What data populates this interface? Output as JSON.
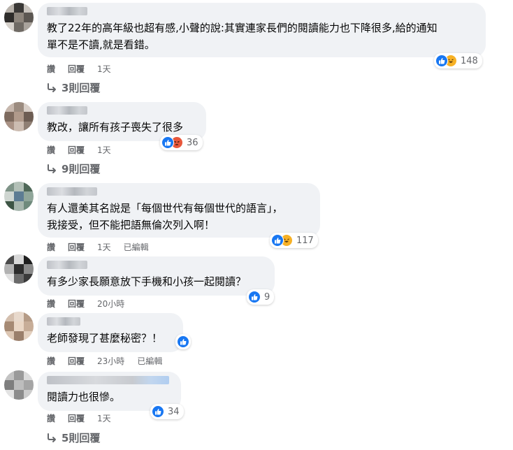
{
  "labels": {
    "like": "讚",
    "reply": "回覆",
    "edited": "已編輯"
  },
  "comments": [
    {
      "text": "教了22年的高年級也超有感,小聲的說:其實連家長們的閱讀能力也下降很多,給的通知\n單不是不讀,就是看錯。",
      "reactions": [
        "like",
        "haha"
      ],
      "count": "148",
      "time": "1天",
      "edited": false,
      "replies": "3則回覆"
    },
    {
      "text": "教改，讓所有孩子喪失了很多",
      "reactions": [
        "like",
        "angry"
      ],
      "count": "36",
      "time": "1天",
      "edited": false,
      "replies": "9則回覆"
    },
    {
      "text": "有人還美其名說是「每個世代有每個世代的語言」，\n我接受，但不能把語無倫次列入啊！",
      "reactions": [
        "like",
        "haha"
      ],
      "count": "117",
      "time": "1天",
      "edited": true,
      "replies": ""
    },
    {
      "text": "有多少家長願意放下手機和小孩一起閱讀？",
      "reactions": [
        "like"
      ],
      "count": "9",
      "time": "20小時",
      "edited": false,
      "replies": ""
    },
    {
      "text": "老師發現了甚麼秘密？！",
      "reactions": [
        "like"
      ],
      "count": "",
      "time": "23小時",
      "edited": true,
      "replies": ""
    },
    {
      "text": "閱讀力也很慘。",
      "reactions": [
        "like"
      ],
      "count": "34",
      "time": "1天",
      "edited": false,
      "replies": "5則回覆"
    }
  ],
  "colors": {
    "bubble": "#f0f2f5",
    "meta": "#65676b",
    "like": "#1877f2",
    "haha": "#f7b125",
    "angry": "#e8573b"
  }
}
